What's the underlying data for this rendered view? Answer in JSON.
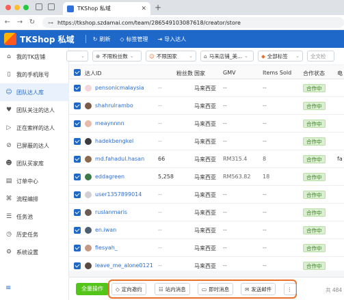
{
  "browser": {
    "tab_title": "TKShop 私域",
    "url": "https://tkshop.szdamai.com/team/286549103087618/creator/store"
  },
  "header": {
    "brand": "TKShop 私域",
    "buttons": [
      {
        "label": "刷新",
        "icon": "refresh-icon"
      },
      {
        "label": "标签管理",
        "icon": "tag-icon"
      },
      {
        "label": "导入达人",
        "icon": "import-icon"
      }
    ]
  },
  "sidebar": {
    "items": [
      {
        "label": "我的TK店铺",
        "icon": "store-icon",
        "active": false
      },
      {
        "label": "我的手机账号",
        "icon": "phone-icon",
        "active": false
      },
      {
        "label": "团队达人库",
        "icon": "team-library-icon",
        "active": true
      },
      {
        "label": "团队关注的达人",
        "icon": "follow-icon",
        "active": false
      },
      {
        "label": "正在索样的达人",
        "icon": "sample-icon",
        "active": false
      },
      {
        "label": "已屏蔽的达人",
        "icon": "blocked-icon",
        "active": false
      },
      {
        "label": "团队买家库",
        "icon": "buyer-icon",
        "active": false
      },
      {
        "label": "订单中心",
        "icon": "order-icon",
        "active": false
      },
      {
        "label": "流程编排",
        "icon": "flow-icon",
        "active": false
      },
      {
        "label": "任务池",
        "icon": "task-pool-icon",
        "active": false
      },
      {
        "label": "历史任务",
        "icon": "history-icon",
        "active": false
      },
      {
        "label": "系统设置",
        "icon": "settings-icon",
        "active": false
      }
    ]
  },
  "filters": [
    {
      "label": "",
      "icon": ""
    },
    {
      "label": "不限粉丝数",
      "icon": "fans-icon"
    },
    {
      "label": "不限国家",
      "icon": "country-icon"
    },
    {
      "label": "马来店铺_美...",
      "icon": "shop-icon"
    },
    {
      "label": "全部标签",
      "icon": "tag-icon"
    },
    {
      "label": "全文检",
      "icon": ""
    }
  ],
  "table": {
    "columns": [
      "达人ID",
      "粉丝数",
      "国家",
      "GMV",
      "Items Sold",
      "合作状态",
      "电"
    ],
    "rows": [
      {
        "id": "pensonicmalaysia",
        "fans": "--",
        "country": "马来西亚",
        "gmv": "--",
        "items": "--",
        "status": "合作中",
        "extra": "",
        "avatar": "#f3d6dc"
      },
      {
        "id": "shahrulrambo",
        "fans": "--",
        "country": "马来西亚",
        "gmv": "--",
        "items": "--",
        "status": "合作中",
        "extra": "",
        "avatar": "#7a5a48"
      },
      {
        "id": "meaynnnn",
        "fans": "--",
        "country": "马来西亚",
        "gmv": "--",
        "items": "--",
        "status": "合作中",
        "extra": "",
        "avatar": "#e7b9a6"
      },
      {
        "id": "hadekbengkel",
        "fans": "--",
        "country": "马来西亚",
        "gmv": "--",
        "items": "--",
        "status": "合作中",
        "extra": "",
        "avatar": "#3b3b3b"
      },
      {
        "id": "md.fahadul.hasan",
        "fans": "66",
        "country": "马来西亚",
        "gmv": "RM315.4",
        "items": "8",
        "status": "合作中",
        "extra": "fa",
        "avatar": "#8b6b4e"
      },
      {
        "id": "eddagreen",
        "fans": "5,258",
        "country": "马来西亚",
        "gmv": "RM563.82",
        "items": "18",
        "status": "合作中",
        "extra": "",
        "avatar": "#3c7a4a"
      },
      {
        "id": "user1357899014",
        "fans": "--",
        "country": "马来西亚",
        "gmv": "--",
        "items": "--",
        "status": "合作中",
        "extra": "",
        "avatar": "#d0d0d0"
      },
      {
        "id": "ruslanmaris",
        "fans": "--",
        "country": "马来西亚",
        "gmv": "--",
        "items": "--",
        "status": "合作中",
        "extra": "",
        "avatar": "#6b5d55"
      },
      {
        "id": "en.iwan",
        "fans": "--",
        "country": "马来西亚",
        "gmv": "--",
        "items": "--",
        "status": "合作中",
        "extra": "",
        "avatar": "#4f5e6e"
      },
      {
        "id": "fiesyah_",
        "fans": "--",
        "country": "马来西亚",
        "gmv": "--",
        "items": "--",
        "status": "合作中",
        "extra": "",
        "avatar": "#c49a86"
      },
      {
        "id": "leave_me_alone0121",
        "fans": "--",
        "country": "马来西亚",
        "gmv": "--",
        "items": "--",
        "status": "合作中",
        "extra": "",
        "avatar": "#5a4a42"
      }
    ]
  },
  "footer": {
    "bulk_label": "全量操作",
    "actions": [
      {
        "label": "定向邀约",
        "icon": "invite-icon"
      },
      {
        "label": "站内消息",
        "icon": "message-icon"
      },
      {
        "label": "即时消息",
        "icon": "chat-icon"
      },
      {
        "label": "发送邮件",
        "icon": "mail-icon"
      }
    ],
    "more_label": "⋮",
    "total": "共 484 条"
  },
  "colors": {
    "primary": "#1e68c9",
    "highlight": "#e8702a",
    "success": "#52c41a"
  }
}
